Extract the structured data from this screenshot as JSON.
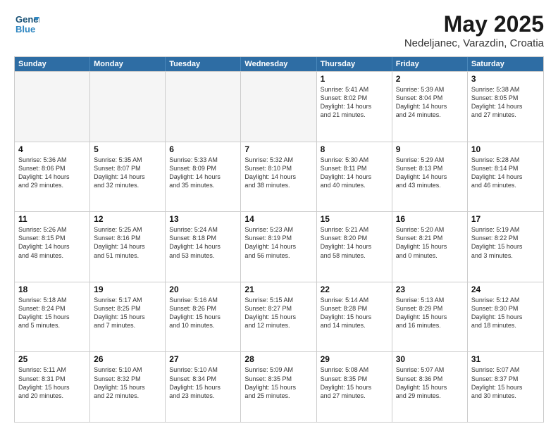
{
  "header": {
    "logo_line1": "General",
    "logo_line2": "Blue",
    "title": "May 2025",
    "subtitle": "Nedeljanec, Varazdin, Croatia"
  },
  "weekdays": [
    "Sunday",
    "Monday",
    "Tuesday",
    "Wednesday",
    "Thursday",
    "Friday",
    "Saturday"
  ],
  "rows": [
    [
      {
        "day": "",
        "empty": true,
        "info": ""
      },
      {
        "day": "",
        "empty": true,
        "info": ""
      },
      {
        "day": "",
        "empty": true,
        "info": ""
      },
      {
        "day": "",
        "empty": true,
        "info": ""
      },
      {
        "day": "1",
        "empty": false,
        "info": "Sunrise: 5:41 AM\nSunset: 8:02 PM\nDaylight: 14 hours\nand 21 minutes."
      },
      {
        "day": "2",
        "empty": false,
        "info": "Sunrise: 5:39 AM\nSunset: 8:04 PM\nDaylight: 14 hours\nand 24 minutes."
      },
      {
        "day": "3",
        "empty": false,
        "info": "Sunrise: 5:38 AM\nSunset: 8:05 PM\nDaylight: 14 hours\nand 27 minutes."
      }
    ],
    [
      {
        "day": "4",
        "empty": false,
        "info": "Sunrise: 5:36 AM\nSunset: 8:06 PM\nDaylight: 14 hours\nand 29 minutes."
      },
      {
        "day": "5",
        "empty": false,
        "info": "Sunrise: 5:35 AM\nSunset: 8:07 PM\nDaylight: 14 hours\nand 32 minutes."
      },
      {
        "day": "6",
        "empty": false,
        "info": "Sunrise: 5:33 AM\nSunset: 8:09 PM\nDaylight: 14 hours\nand 35 minutes."
      },
      {
        "day": "7",
        "empty": false,
        "info": "Sunrise: 5:32 AM\nSunset: 8:10 PM\nDaylight: 14 hours\nand 38 minutes."
      },
      {
        "day": "8",
        "empty": false,
        "info": "Sunrise: 5:30 AM\nSunset: 8:11 PM\nDaylight: 14 hours\nand 40 minutes."
      },
      {
        "day": "9",
        "empty": false,
        "info": "Sunrise: 5:29 AM\nSunset: 8:13 PM\nDaylight: 14 hours\nand 43 minutes."
      },
      {
        "day": "10",
        "empty": false,
        "info": "Sunrise: 5:28 AM\nSunset: 8:14 PM\nDaylight: 14 hours\nand 46 minutes."
      }
    ],
    [
      {
        "day": "11",
        "empty": false,
        "info": "Sunrise: 5:26 AM\nSunset: 8:15 PM\nDaylight: 14 hours\nand 48 minutes."
      },
      {
        "day": "12",
        "empty": false,
        "info": "Sunrise: 5:25 AM\nSunset: 8:16 PM\nDaylight: 14 hours\nand 51 minutes."
      },
      {
        "day": "13",
        "empty": false,
        "info": "Sunrise: 5:24 AM\nSunset: 8:18 PM\nDaylight: 14 hours\nand 53 minutes."
      },
      {
        "day": "14",
        "empty": false,
        "info": "Sunrise: 5:23 AM\nSunset: 8:19 PM\nDaylight: 14 hours\nand 56 minutes."
      },
      {
        "day": "15",
        "empty": false,
        "info": "Sunrise: 5:21 AM\nSunset: 8:20 PM\nDaylight: 14 hours\nand 58 minutes."
      },
      {
        "day": "16",
        "empty": false,
        "info": "Sunrise: 5:20 AM\nSunset: 8:21 PM\nDaylight: 15 hours\nand 0 minutes."
      },
      {
        "day": "17",
        "empty": false,
        "info": "Sunrise: 5:19 AM\nSunset: 8:22 PM\nDaylight: 15 hours\nand 3 minutes."
      }
    ],
    [
      {
        "day": "18",
        "empty": false,
        "info": "Sunrise: 5:18 AM\nSunset: 8:24 PM\nDaylight: 15 hours\nand 5 minutes."
      },
      {
        "day": "19",
        "empty": false,
        "info": "Sunrise: 5:17 AM\nSunset: 8:25 PM\nDaylight: 15 hours\nand 7 minutes."
      },
      {
        "day": "20",
        "empty": false,
        "info": "Sunrise: 5:16 AM\nSunset: 8:26 PM\nDaylight: 15 hours\nand 10 minutes."
      },
      {
        "day": "21",
        "empty": false,
        "info": "Sunrise: 5:15 AM\nSunset: 8:27 PM\nDaylight: 15 hours\nand 12 minutes."
      },
      {
        "day": "22",
        "empty": false,
        "info": "Sunrise: 5:14 AM\nSunset: 8:28 PM\nDaylight: 15 hours\nand 14 minutes."
      },
      {
        "day": "23",
        "empty": false,
        "info": "Sunrise: 5:13 AM\nSunset: 8:29 PM\nDaylight: 15 hours\nand 16 minutes."
      },
      {
        "day": "24",
        "empty": false,
        "info": "Sunrise: 5:12 AM\nSunset: 8:30 PM\nDaylight: 15 hours\nand 18 minutes."
      }
    ],
    [
      {
        "day": "25",
        "empty": false,
        "info": "Sunrise: 5:11 AM\nSunset: 8:31 PM\nDaylight: 15 hours\nand 20 minutes."
      },
      {
        "day": "26",
        "empty": false,
        "info": "Sunrise: 5:10 AM\nSunset: 8:32 PM\nDaylight: 15 hours\nand 22 minutes."
      },
      {
        "day": "27",
        "empty": false,
        "info": "Sunrise: 5:10 AM\nSunset: 8:34 PM\nDaylight: 15 hours\nand 23 minutes."
      },
      {
        "day": "28",
        "empty": false,
        "info": "Sunrise: 5:09 AM\nSunset: 8:35 PM\nDaylight: 15 hours\nand 25 minutes."
      },
      {
        "day": "29",
        "empty": false,
        "info": "Sunrise: 5:08 AM\nSunset: 8:35 PM\nDaylight: 15 hours\nand 27 minutes."
      },
      {
        "day": "30",
        "empty": false,
        "info": "Sunrise: 5:07 AM\nSunset: 8:36 PM\nDaylight: 15 hours\nand 29 minutes."
      },
      {
        "day": "31",
        "empty": false,
        "info": "Sunrise: 5:07 AM\nSunset: 8:37 PM\nDaylight: 15 hours\nand 30 minutes."
      }
    ]
  ]
}
